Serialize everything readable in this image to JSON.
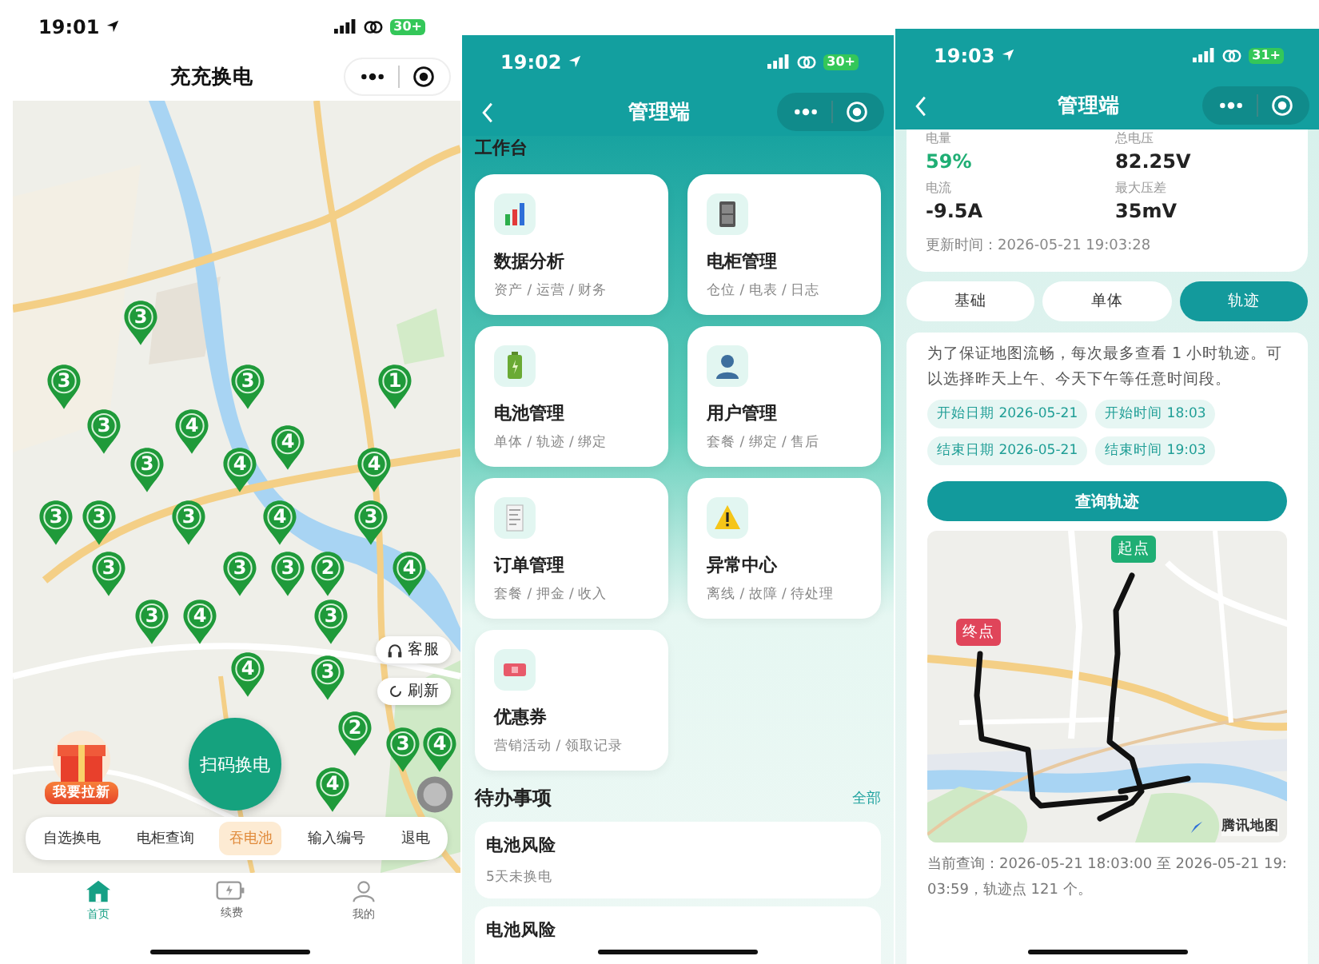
{
  "home_screen": {
    "status_bar": {
      "time": "19:01",
      "battery": "30+"
    },
    "title": "充充换电",
    "pins": [
      {
        "count": "3"
      },
      {
        "count": "3"
      },
      {
        "count": "3"
      },
      {
        "count": "1"
      },
      {
        "count": "3"
      },
      {
        "count": "4"
      },
      {
        "count": "4"
      },
      {
        "count": "3"
      },
      {
        "count": "4"
      },
      {
        "count": "4"
      },
      {
        "count": "3"
      },
      {
        "count": "3"
      },
      {
        "count": "3"
      },
      {
        "count": "4"
      },
      {
        "count": "3"
      },
      {
        "count": "3"
      },
      {
        "count": "3"
      },
      {
        "count": "3"
      },
      {
        "count": "2"
      },
      {
        "count": "4"
      },
      {
        "count": "3"
      },
      {
        "count": "4"
      },
      {
        "count": "3"
      },
      {
        "count": "4"
      },
      {
        "count": "3"
      },
      {
        "count": "2"
      },
      {
        "count": "3"
      },
      {
        "count": "4"
      },
      {
        "count": "4"
      }
    ],
    "side_buttons": [
      "客服",
      "刷新"
    ],
    "promo": "我要拉新",
    "scan_button": "扫码换电",
    "actions": [
      {
        "label": "自选换电",
        "selected": false
      },
      {
        "label": "电柜查询",
        "selected": false
      },
      {
        "label": "吞电池",
        "selected": true
      },
      {
        "label": "输入编号",
        "selected": false
      },
      {
        "label": "退电",
        "selected": false
      }
    ],
    "tabs": [
      {
        "label": "首页",
        "selected": true
      },
      {
        "label": "续费",
        "selected": false
      },
      {
        "label": "我的",
        "selected": false
      }
    ]
  },
  "admin_screen": {
    "status_bar": {
      "time": "19:02",
      "battery": "30+"
    },
    "title": "管理端",
    "section_title": "工作台",
    "cards": [
      {
        "title": "数据分析",
        "subtitle": "资产 / 运营 / 财务"
      },
      {
        "title": "电柜管理",
        "subtitle": "仓位 / 电表 / 日志"
      },
      {
        "title": "电池管理",
        "subtitle": "单体 / 轨迹 / 绑定"
      },
      {
        "title": "用户管理",
        "subtitle": "套餐 / 绑定 / 售后"
      },
      {
        "title": "订单管理",
        "subtitle": "套餐 / 押金 / 收入"
      },
      {
        "title": "异常中心",
        "subtitle": "离线 / 故障 / 待处理"
      },
      {
        "title": "优惠券",
        "subtitle": "营销活动 / 领取记录"
      }
    ],
    "todo_title": "待办事项",
    "todo_link": "全部",
    "todos": [
      {
        "title": "电池风险",
        "detail": "5天未换电"
      },
      {
        "title": "电池风险"
      }
    ]
  },
  "track_screen": {
    "status_bar": {
      "time": "19:03",
      "battery": "31+"
    },
    "title": "管理端",
    "metrics": [
      {
        "label": "电量",
        "value": "59%",
        "color": "#1fae74"
      },
      {
        "label": "总电压",
        "value": "82.25V",
        "color": "#222222"
      },
      {
        "label": "电流",
        "value": "-9.5A",
        "color": "#222222"
      },
      {
        "label": "最大压差",
        "value": "35mV",
        "color": "#222222"
      }
    ],
    "updated": "更新时间：2026-05-21 19:03:28",
    "tabs": [
      {
        "label": "基础",
        "selected": false
      },
      {
        "label": "单体",
        "selected": false
      },
      {
        "label": "轨迹",
        "selected": true
      }
    ],
    "notice": "为了保证地图流畅，每次最多查看 1 小时轨迹。可以选择昨天上午、今天下午等任意时间段。",
    "chips": [
      "开始日期 2026-05-21",
      "开始时间 18:03",
      "结束日期 2026-05-21",
      "结束时间 19:03"
    ],
    "query_button": "查询轨迹",
    "map_markers": [
      {
        "label": "起点",
        "kind": "start"
      },
      {
        "label": "终点",
        "kind": "end"
      }
    ],
    "map_attribution": "腾讯地图",
    "summary": "当前查询：2026-05-21 18:03:00 至 2026-05-21 19:03:59，轨迹点 121 个。"
  }
}
